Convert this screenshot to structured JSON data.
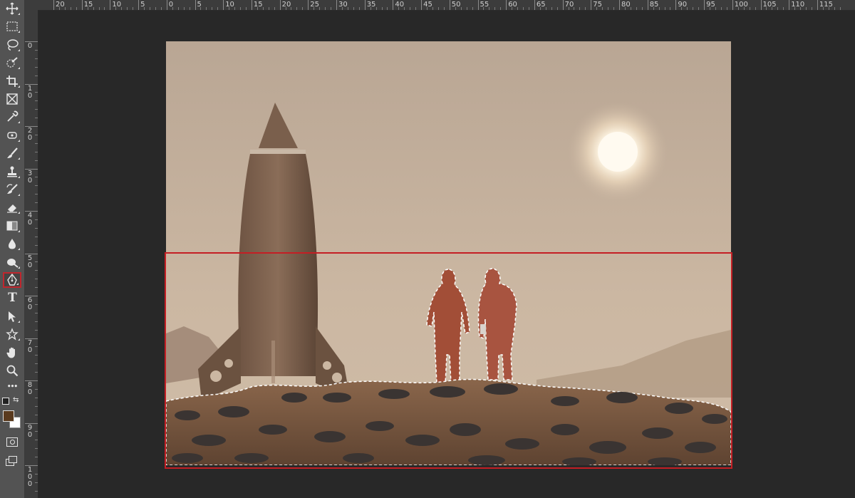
{
  "rulers": {
    "horizontal_labels": [
      "20",
      "15",
      "10",
      "5",
      "0",
      "5",
      "10",
      "15",
      "20",
      "25",
      "30",
      "35",
      "40",
      "45",
      "50",
      "55",
      "60",
      "65",
      "70",
      "75",
      "80",
      "85",
      "90",
      "95",
      "100",
      "105",
      "110",
      "115"
    ],
    "vertical_labels": [
      "0",
      "10",
      "20",
      "30",
      "40",
      "50",
      "60",
      "70",
      "80",
      "90",
      "100"
    ]
  },
  "toolbar": {
    "tools": [
      {
        "name": "move-tool",
        "icon": "move-icon"
      },
      {
        "name": "marquee-tool",
        "icon": "rect-marquee-icon"
      },
      {
        "name": "lasso-tool",
        "icon": "lasso-icon"
      },
      {
        "name": "quick-selection-tool",
        "icon": "quick-selection-icon"
      },
      {
        "name": "crop-tool",
        "icon": "crop-icon"
      },
      {
        "name": "frame-tool",
        "icon": "frame-icon"
      },
      {
        "name": "eyedropper-tool",
        "icon": "eyedropper-icon"
      },
      {
        "name": "healing-brush-tool",
        "icon": "bandage-icon"
      },
      {
        "name": "brush-tool",
        "icon": "brush-icon"
      },
      {
        "name": "clone-stamp-tool",
        "icon": "stamp-icon"
      },
      {
        "name": "history-brush-tool",
        "icon": "history-brush-icon"
      },
      {
        "name": "eraser-tool",
        "icon": "eraser-icon"
      },
      {
        "name": "gradient-tool",
        "icon": "gradient-icon"
      },
      {
        "name": "blur-tool",
        "icon": "drop-icon"
      },
      {
        "name": "dodge-tool",
        "icon": "dodge-icon"
      },
      {
        "name": "pen-tool",
        "icon": "pen-icon",
        "active": true
      },
      {
        "name": "type-tool",
        "icon": "type-icon",
        "glyph": "T"
      },
      {
        "name": "path-selection-tool",
        "icon": "arrow-icon"
      },
      {
        "name": "shape-tool",
        "icon": "shape-icon"
      },
      {
        "name": "hand-tool",
        "icon": "hand-icon"
      },
      {
        "name": "zoom-tool",
        "icon": "zoom-icon"
      },
      {
        "name": "edit-toolbar",
        "icon": "ellipsis-icon",
        "glyph": "•••"
      }
    ],
    "foreground_color": "#5a3a1e",
    "background_color": "#ffffff",
    "accent_color": "#c0262d"
  },
  "canvas": {
    "sky_top": "#bba896",
    "sky_bottom": "#cdb9a5",
    "ground_color": "#7a5a43",
    "selection_highlight_color": "#c41e24"
  }
}
